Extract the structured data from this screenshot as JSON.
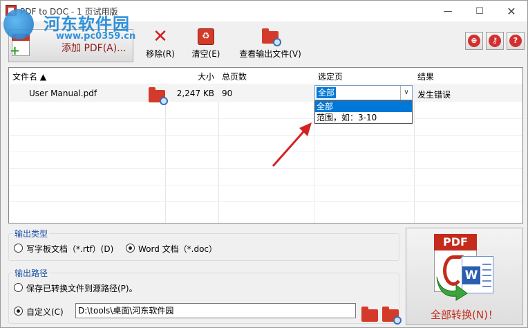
{
  "window": {
    "title": "PDF to DOC - 1 页试用版",
    "minimize": "—",
    "maximize": "☐",
    "close": "✕"
  },
  "watermark": {
    "text": "河东软件园",
    "url": "www.pc0359.cn"
  },
  "toolbar": {
    "add_label": "添加 PDF(A)...",
    "remove_label": "移除(R)",
    "clear_label": "清空(E)",
    "view_output_label": "查看输出文件(V)",
    "help_glyph": "?",
    "globe_glyph": "⊕",
    "key_glyph": "⚷"
  },
  "list": {
    "columns": [
      "文件名 ▲",
      "大小",
      "总页数",
      "选定页",
      "结果"
    ],
    "rows": [
      {
        "name": "User Manual.pdf",
        "size": "2,247 KB",
        "pages": "90",
        "selected": "全部",
        "result": "发生错误"
      }
    ],
    "dropdown_options": [
      "全部",
      "范围，如：3-10"
    ]
  },
  "output_type": {
    "title": "输出类型",
    "options": [
      "写字板文档（*.rtf）(D)",
      "Word 文档（*.doc）"
    ],
    "selected_index": 1
  },
  "output_path": {
    "title": "输出路径",
    "source_option": "保存已转换文件到源路径(P)。",
    "custom_option": "自定义(C)",
    "selected": "custom",
    "path_value": "D:\\tools\\桌面\\河东软件园"
  },
  "convert": {
    "label": "全部转换(N)！",
    "pdf_badge": "PDF",
    "word_badge": "W"
  },
  "colors": {
    "accent_red": "#c42b1c",
    "selection_blue": "#0078d7",
    "group_title_blue": "#1c50a8",
    "watermark_blue": "#1e88d8"
  }
}
